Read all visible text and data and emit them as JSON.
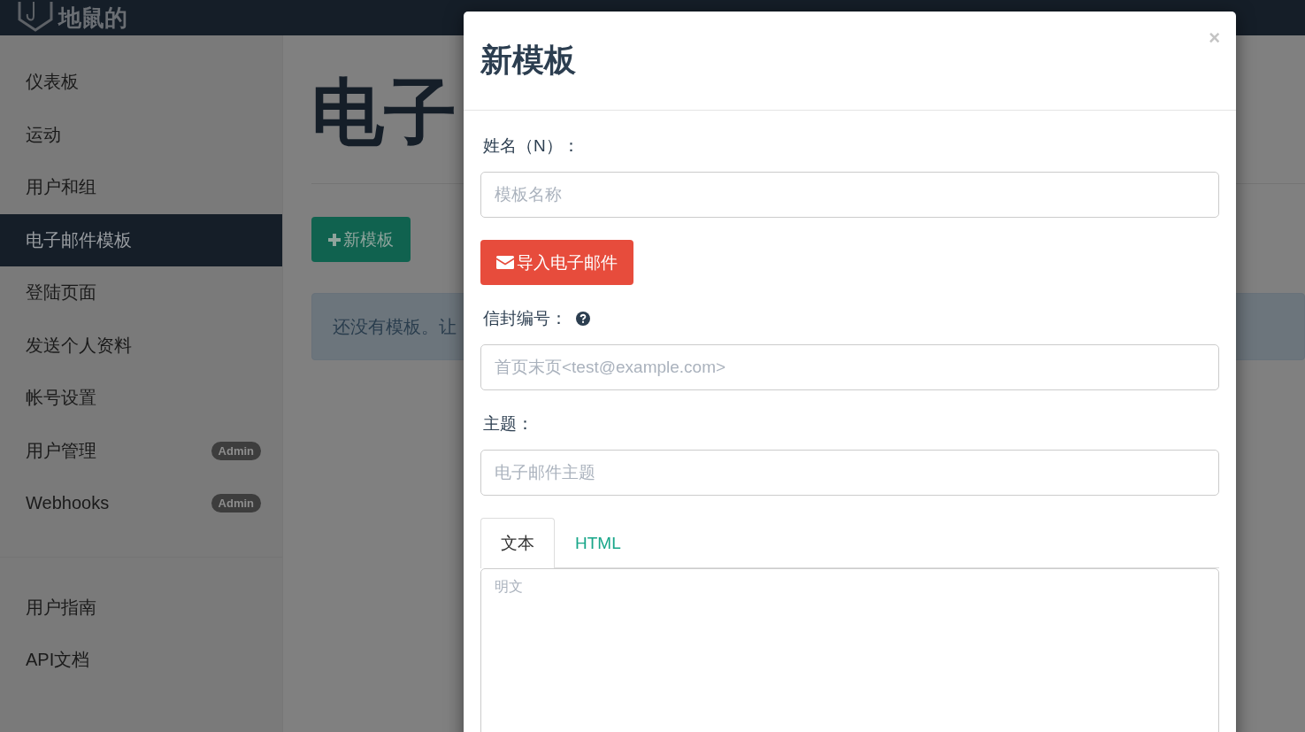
{
  "header": {
    "logo": "地鼠的"
  },
  "sidebar": {
    "items": [
      {
        "label": "仪表板",
        "selected": false
      },
      {
        "label": "运动",
        "selected": false
      },
      {
        "label": "用户和组",
        "selected": false
      },
      {
        "label": "电子邮件模板",
        "selected": true
      },
      {
        "label": "登陆页面",
        "selected": false
      },
      {
        "label": "发送个人资料",
        "selected": false
      },
      {
        "label": "帐号设置",
        "selected": false
      },
      {
        "label": "用户管理",
        "selected": false,
        "badge": "Admin"
      },
      {
        "label": "Webhooks",
        "selected": false,
        "badge": "Admin"
      }
    ],
    "footer_items": [
      {
        "label": "用户指南",
        "selected": false
      },
      {
        "label": "API文档",
        "selected": false
      }
    ]
  },
  "main": {
    "title": "电子",
    "new_button": "新模板",
    "alert": "还没有模板。让"
  },
  "modal": {
    "title": "新模板",
    "close": "×",
    "fields": [
      {
        "kind": "input",
        "label": "姓名（N）：",
        "placeholder": "模板名称"
      },
      {
        "kind": "button",
        "label": "导入电子邮件"
      },
      {
        "kind": "input",
        "label": "信封编号：",
        "help": true,
        "placeholder": "首页末页<test@example.com>"
      },
      {
        "kind": "input",
        "label": "主题：",
        "placeholder": "电子邮件主题"
      }
    ],
    "tabs": [
      {
        "label": "文本",
        "selected": true
      },
      {
        "label": "HTML",
        "selected": false
      }
    ],
    "textarea": {
      "placeholder": "明文"
    }
  }
}
